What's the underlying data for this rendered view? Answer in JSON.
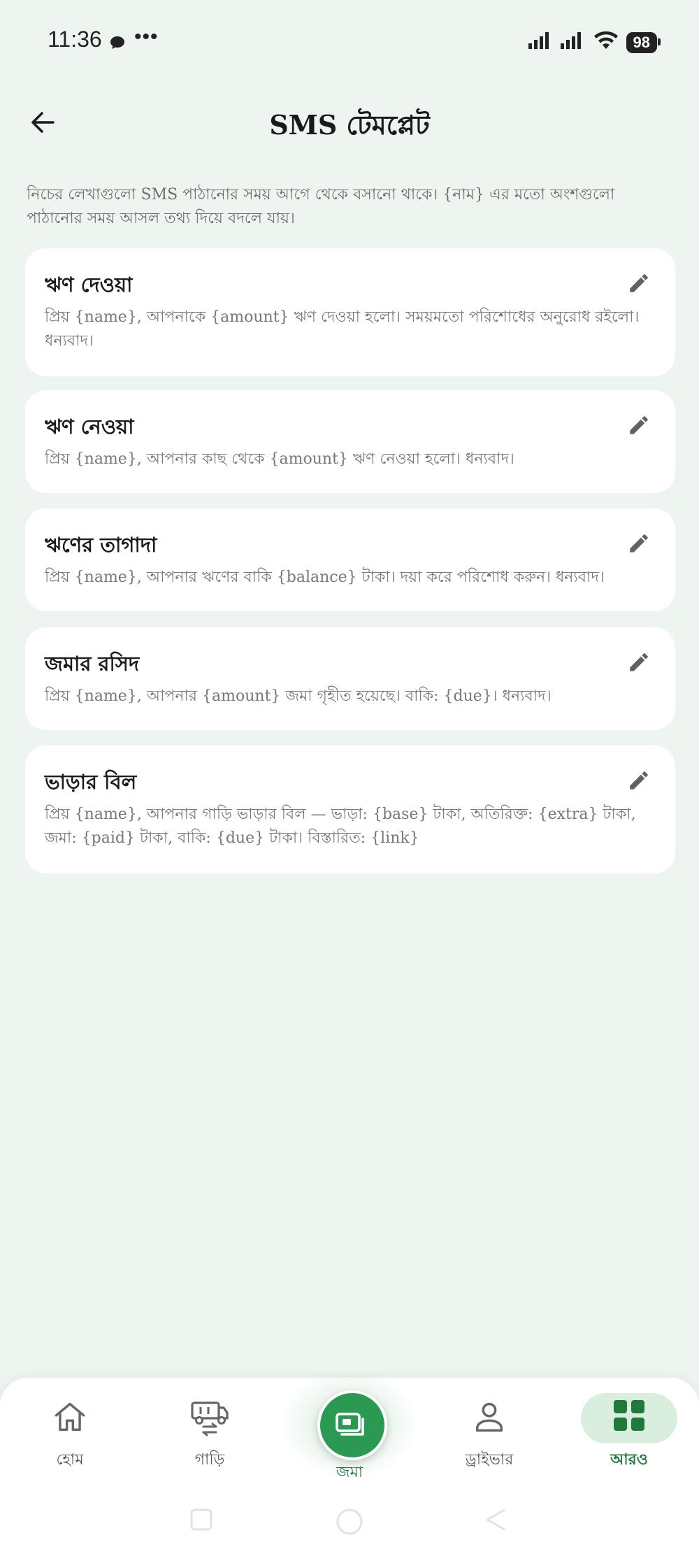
{
  "status_bar": {
    "time": "11:36",
    "battery": "98"
  },
  "header": {
    "title": "SMS টেমপ্লেট"
  },
  "intro": "নিচের লেখাগুলো SMS পাঠানোর সময় আগে থেকে বসানো থাকে। {নাম} এর মতো অংশগুলো পাঠানোর সময় আসল তথ্য দিয়ে বদলে যায়।",
  "templates": [
    {
      "title": "ঋণ দেওয়া",
      "body": "প্রিয় {name}, আপনাকে {amount} ঋণ দেওয়া হলো। সময়মতো পরিশোধের অনুরোধ রইলো। ধন্যবাদ।"
    },
    {
      "title": "ঋণ নেওয়া",
      "body": "প্রিয় {name}, আপনার কাছ থেকে {amount} ঋণ নেওয়া হলো। ধন্যবাদ।"
    },
    {
      "title": "ঋণের তাগাদা",
      "body": "প্রিয় {name}, আপনার ঋণের বাকি {balance} টাকা। দয়া করে পরিশোধ করুন। ধন্যবাদ।"
    },
    {
      "title": "জমার রসিদ",
      "body": "প্রিয় {name}, আপনার {amount} জমা গৃহীত হয়েছে। বাকি: {due}। ধন্যবাদ।"
    },
    {
      "title": "ভাড়ার বিল",
      "body": "প্রিয় {name}, আপনার গাড়ি ভাড়ার বিল — ভাড়া: {base} টাকা, অতিরিক্ত: {extra} টাকা, জমা: {paid} টাকা, বাকি: {due} টাকা। বিস্তারিত: {link}"
    }
  ],
  "bottom_nav": {
    "items": [
      {
        "label": "হোম",
        "icon": "home-icon"
      },
      {
        "label": "গাড়ি",
        "icon": "vehicle-icon"
      },
      {
        "label": "জমা",
        "icon": "deposit-icon"
      },
      {
        "label": "ড্রাইভার",
        "icon": "person-icon"
      },
      {
        "label": "আরও",
        "icon": "grid-icon"
      }
    ],
    "active_index": 4
  },
  "colors": {
    "accent": "#2a9a52",
    "active_text": "#1f7a3c",
    "active_pill": "#d9eedd",
    "background": "#eef5f0",
    "icon_gray": "#666666"
  }
}
